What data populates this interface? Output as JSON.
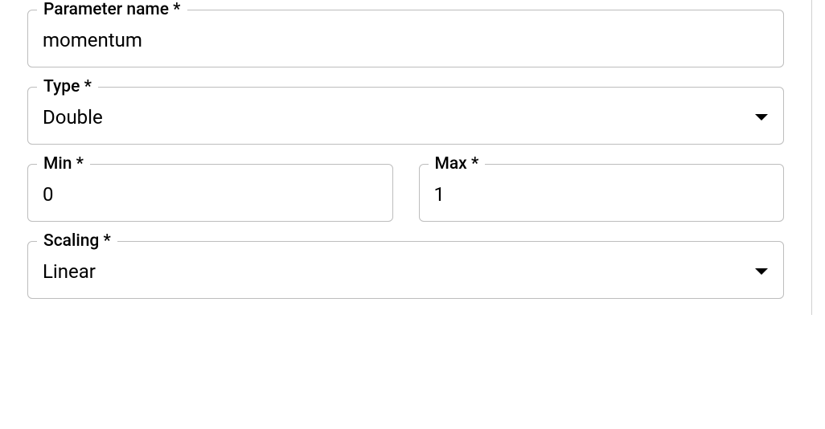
{
  "form": {
    "parameter_name": {
      "label": "Parameter name *",
      "value": "momentum"
    },
    "type": {
      "label": "Type *",
      "value": "Double"
    },
    "min": {
      "label": "Min *",
      "value": "0"
    },
    "max": {
      "label": "Max *",
      "value": "1"
    },
    "scaling": {
      "label": "Scaling *",
      "value": "Linear"
    }
  }
}
